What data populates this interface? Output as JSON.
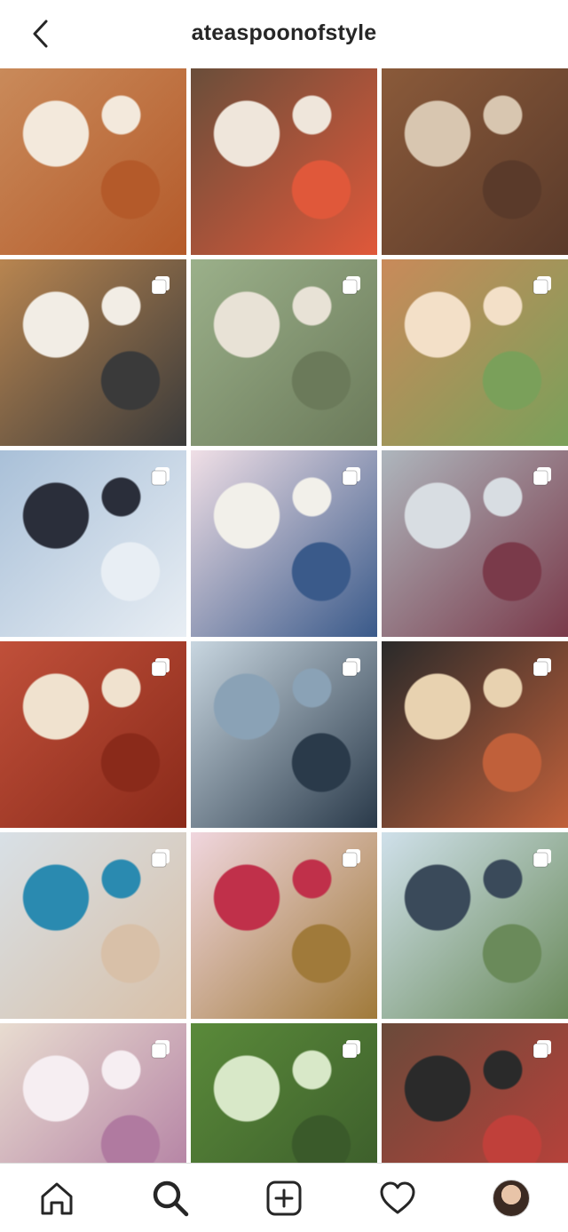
{
  "header": {
    "title": "ateaspoonofstyle",
    "back_icon": "chevron-left-icon"
  },
  "grid": {
    "tiles": [
      {
        "colors": [
          "#c98a5a",
          "#f3e9dc",
          "#b45a2a"
        ],
        "multi": false
      },
      {
        "colors": [
          "#6a4e3a",
          "#efe6db",
          "#e0583a"
        ],
        "multi": false
      },
      {
        "colors": [
          "#8a5a3a",
          "#d8c6b0",
          "#5a3a2a"
        ],
        "multi": false
      },
      {
        "colors": [
          "#b88550",
          "#f2ede5",
          "#3a3a3a"
        ],
        "multi": true
      },
      {
        "colors": [
          "#9bb08a",
          "#e8e2d6",
          "#6b7a5a"
        ],
        "multi": true
      },
      {
        "colors": [
          "#c98a5a",
          "#f3e0c8",
          "#7aa05a"
        ],
        "multi": true
      },
      {
        "colors": [
          "#a9c0d8",
          "#2a2e3a",
          "#e8eef4"
        ],
        "multi": true
      },
      {
        "colors": [
          "#f0dfe6",
          "#f2f0ea",
          "#3a5a8a"
        ],
        "multi": true
      },
      {
        "colors": [
          "#aeb6bd",
          "#d8dde2",
          "#7a3a4a"
        ],
        "multi": true
      },
      {
        "colors": [
          "#c0503a",
          "#f0e2cf",
          "#8a2a1a"
        ],
        "multi": true
      },
      {
        "colors": [
          "#c8d6e0",
          "#8aa2b6",
          "#2a3a4a"
        ],
        "multi": true
      },
      {
        "colors": [
          "#2a2a2a",
          "#e8d2b0",
          "#c0603a"
        ],
        "multi": true
      },
      {
        "colors": [
          "#d8e0e6",
          "#2a8ab0",
          "#d8c0a8"
        ],
        "multi": true
      },
      {
        "colors": [
          "#f0d6de",
          "#c0304a",
          "#a07a3a"
        ],
        "multi": true
      },
      {
        "colors": [
          "#cfe0ea",
          "#3a4a5a",
          "#6a8a5a"
        ],
        "multi": true
      },
      {
        "colors": [
          "#e8dcd0",
          "#f6eef2",
          "#b07aa0"
        ],
        "multi": true
      },
      {
        "colors": [
          "#5a8a3a",
          "#d8e8c8",
          "#3a5a2a"
        ],
        "multi": true
      },
      {
        "colors": [
          "#6a4a3a",
          "#2a2a2a",
          "#c0403a"
        ],
        "multi": true
      }
    ],
    "partial_tiles": [
      {
        "colors": [
          "#e8e6e2",
          "#d0ccc6",
          "#c8c4be"
        ]
      },
      {
        "colors": [
          "#efe8e4",
          "#c8bcbc",
          "#e0d8d4"
        ]
      },
      {
        "colors": [
          "#d87a5a",
          "#e8c0a8",
          "#b0503a"
        ]
      }
    ]
  },
  "nav": {
    "items": [
      {
        "name": "home",
        "icon": "home-icon"
      },
      {
        "name": "search",
        "icon": "search-icon",
        "active": true
      },
      {
        "name": "new-post",
        "icon": "plus-square-icon"
      },
      {
        "name": "activity",
        "icon": "heart-icon"
      },
      {
        "name": "profile",
        "icon": "avatar"
      }
    ]
  },
  "colors": {
    "text": "#262626",
    "divider": "#dbdbdb",
    "background": "#ffffff"
  }
}
